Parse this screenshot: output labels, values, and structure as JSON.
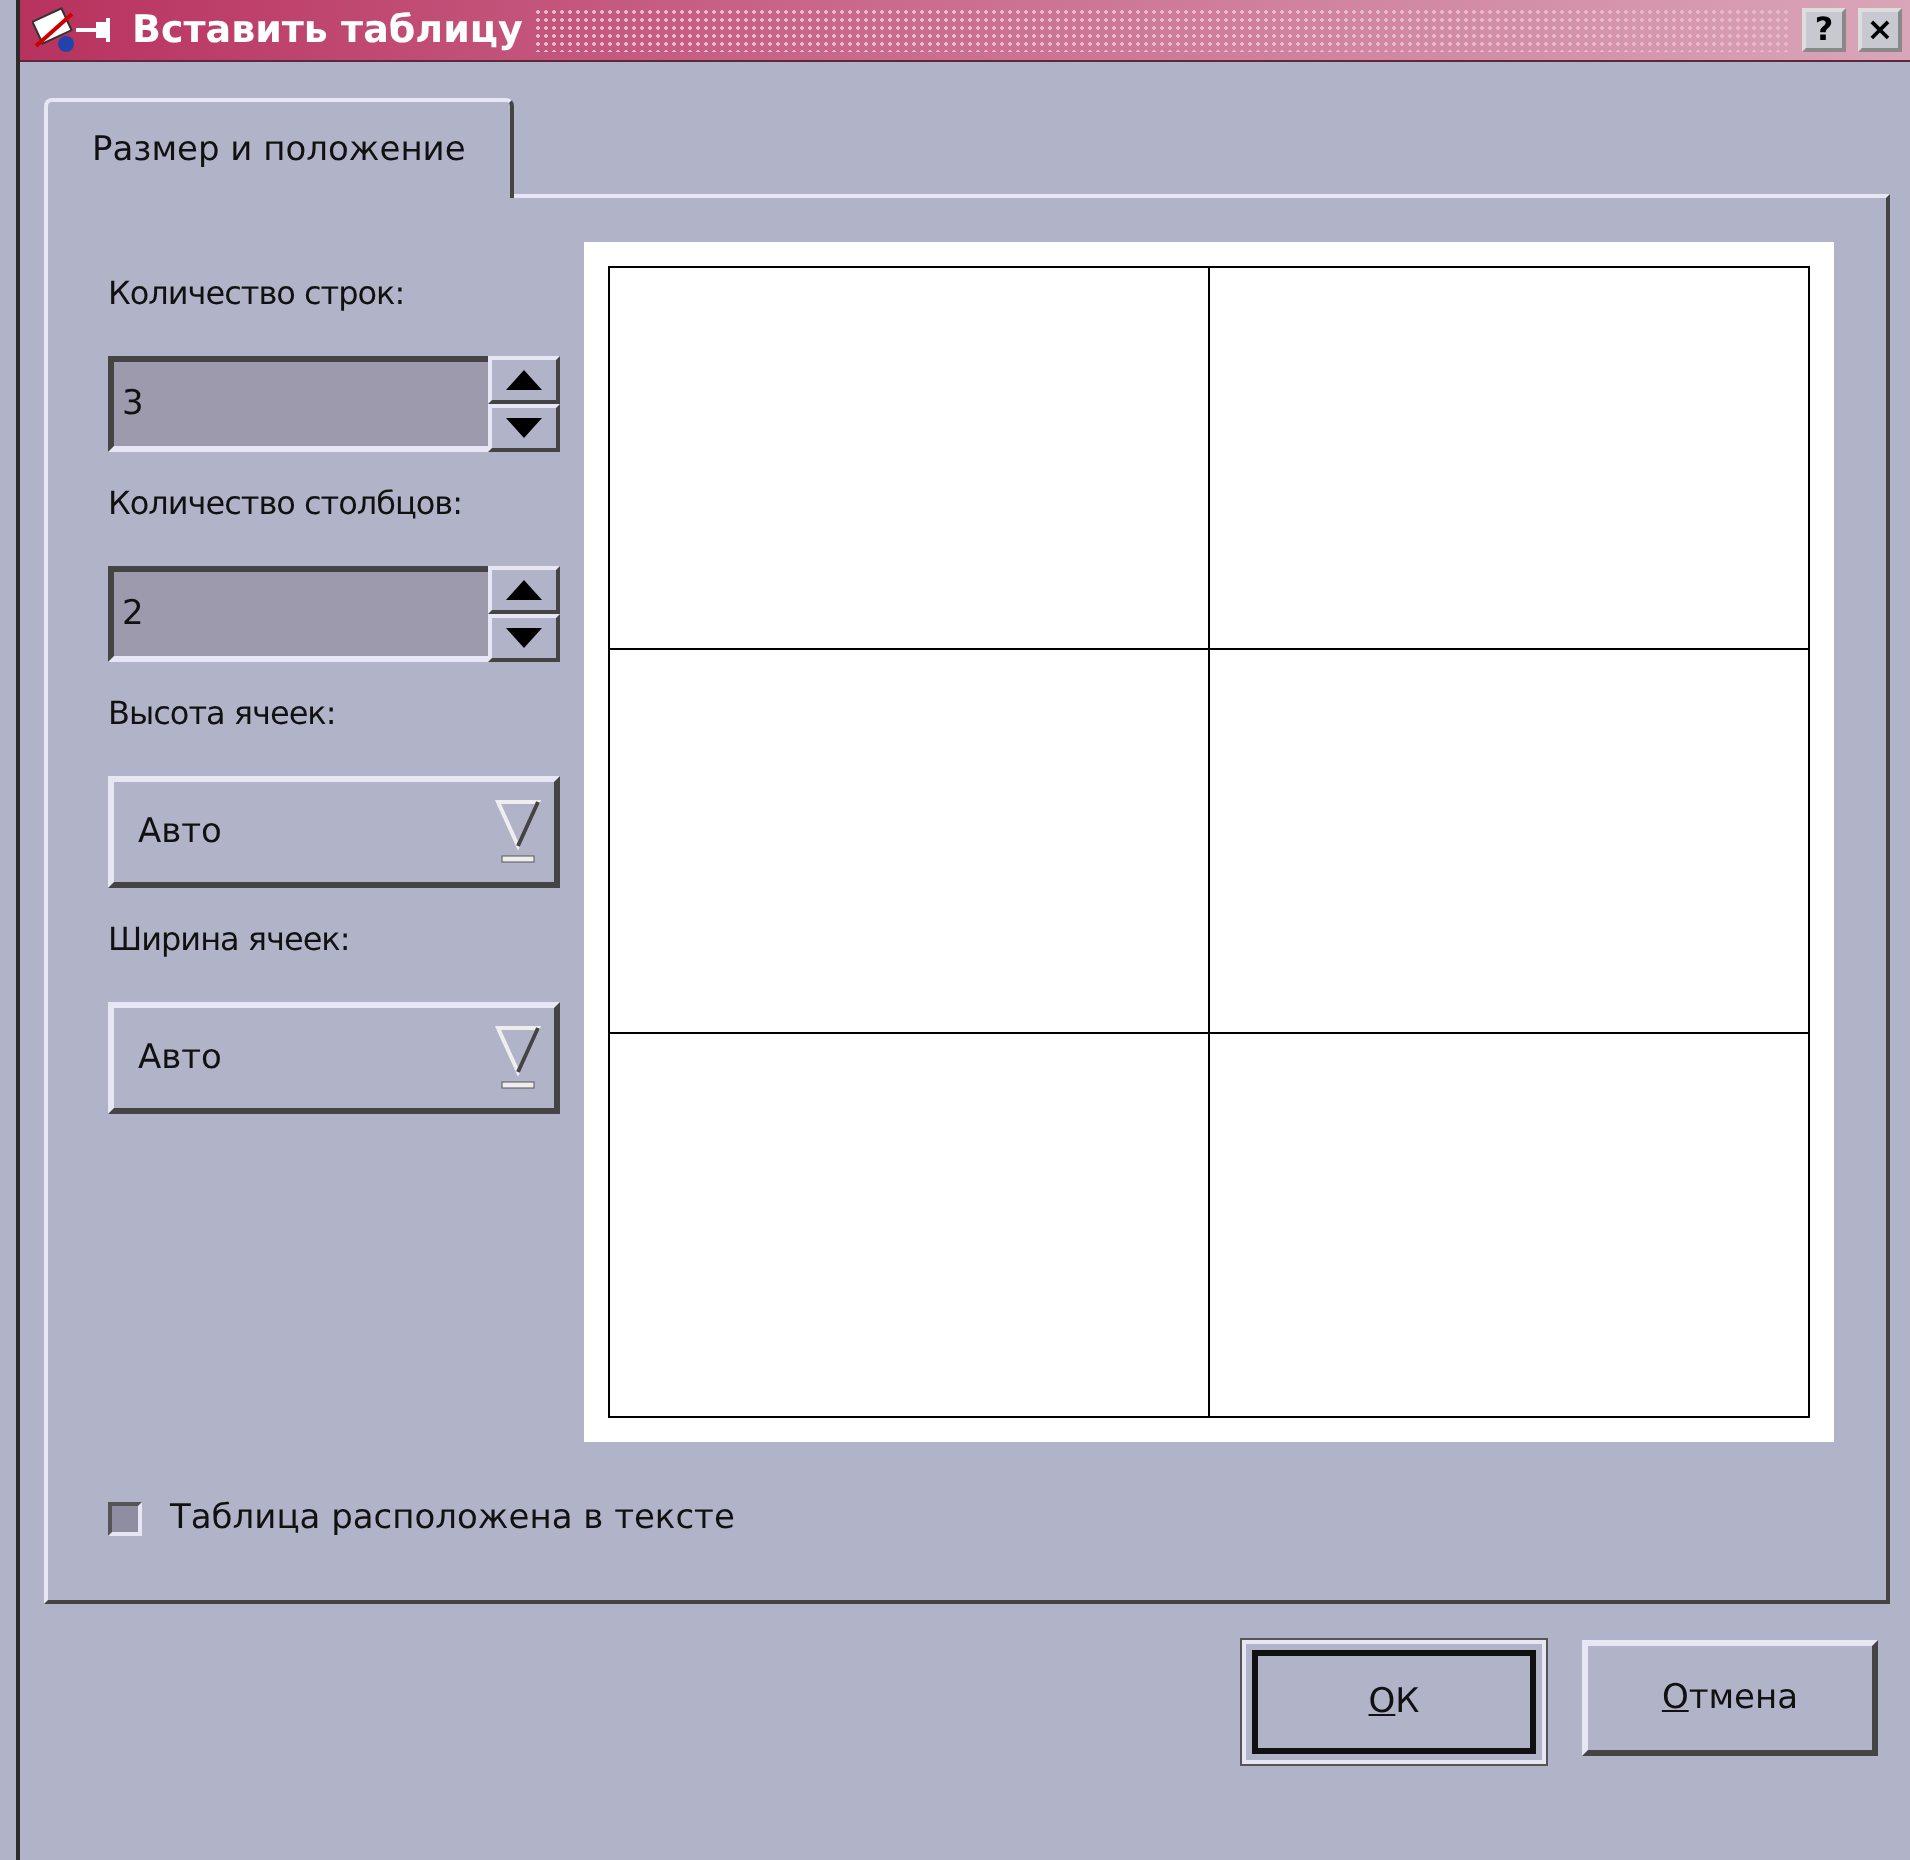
{
  "window": {
    "title": "Вставить таблицу",
    "help_button": "?",
    "close_button": "×"
  },
  "tabs": [
    {
      "label": "Размер и положение",
      "selected": true
    }
  ],
  "fields": [
    {
      "kind": "spin",
      "label": "Количество строк:",
      "value": "3"
    },
    {
      "kind": "spin",
      "label": "Количество столбцов:",
      "value": "2"
    },
    {
      "kind": "dropdown",
      "label": "Высота ячеек:",
      "value": "Авто"
    },
    {
      "kind": "dropdown",
      "label": "Ширина ячеек:",
      "value": "Авто"
    }
  ],
  "inline_checkbox": {
    "label": "Таблица расположена в тексте",
    "checked": false
  },
  "buttons": [
    {
      "label": "ОК",
      "default": true
    },
    {
      "label": "Отмена",
      "default": false
    }
  ]
}
